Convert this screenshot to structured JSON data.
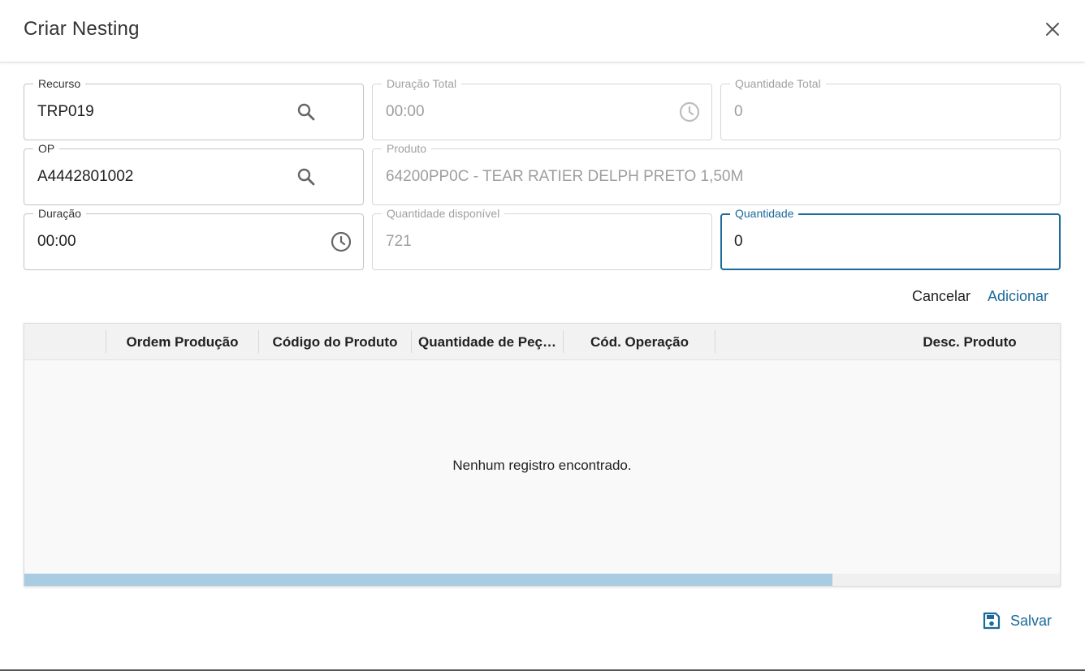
{
  "dialog": {
    "title": "Criar Nesting",
    "close_icon": "close-icon"
  },
  "form": {
    "recurso": {
      "label": "Recurso",
      "value": "TRP019",
      "icon": "search-icon"
    },
    "duracao_total": {
      "label": "Duração Total",
      "value": "00:00",
      "icon": "clock-icon",
      "disabled": true
    },
    "quantidade_total": {
      "label": "Quantidade Total",
      "value": "0",
      "disabled": true
    },
    "op": {
      "label": "OP",
      "value": "A4442801002",
      "icon": "search-icon"
    },
    "produto": {
      "label": "Produto",
      "value": "64200PP0C - TEAR RATIER DELPH PRETO 1,50M",
      "disabled": true
    },
    "duracao": {
      "label": "Duração",
      "value": "00:00",
      "icon": "clock-icon"
    },
    "quantidade_disponivel": {
      "label": "Quantidade disponível",
      "value": "721",
      "disabled": true
    },
    "quantidade": {
      "label": "Quantidade",
      "value": "0",
      "focused": true
    }
  },
  "actions": {
    "cancel_label": "Cancelar",
    "add_label": "Adicionar"
  },
  "grid": {
    "columns": [
      "",
      "Ordem Produção",
      "Código do Produto",
      "Quantidade de Peç…",
      "Cód. Operação",
      "Desc. Produto"
    ],
    "empty_message": "Nenhum registro encontrado.",
    "scroll_fraction": 0.78
  },
  "footer": {
    "save_label": "Salvar",
    "save_icon": "floppy-disk-icon"
  },
  "colors": {
    "accent": "#1a6a9a",
    "scroll_thumb": "#a9cce3"
  }
}
